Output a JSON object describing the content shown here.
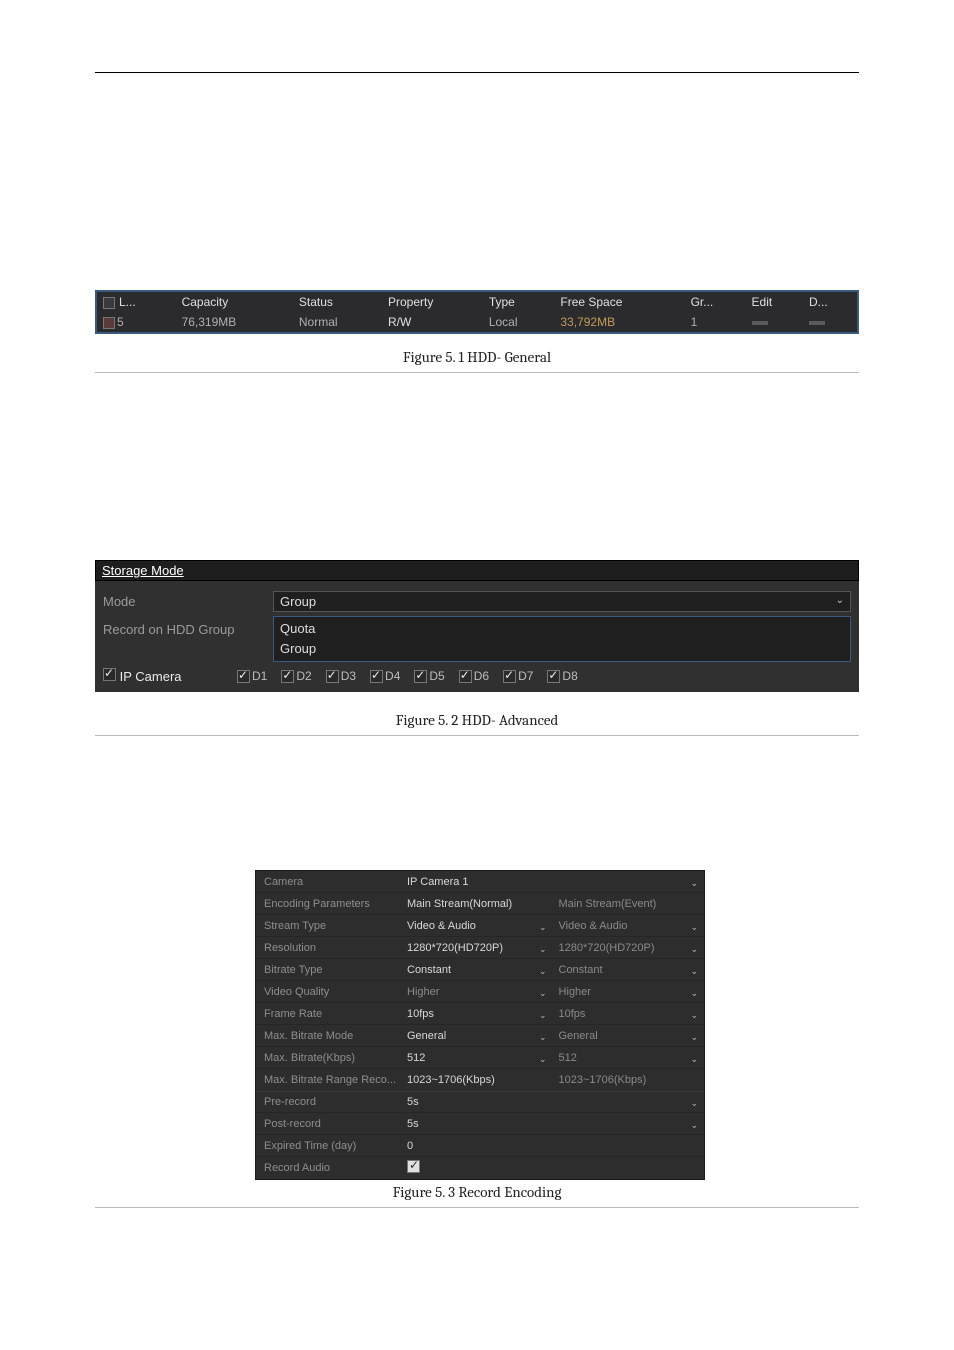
{
  "captions": {
    "fig1": "Figure 5. 1 HDD- General",
    "fig2": "Figure 5. 2 HDD- Advanced",
    "fig3": "Figure 5. 3 Record Encoding"
  },
  "hdd_general": {
    "headers": [
      "L...",
      "Capacity",
      "Status",
      "Property",
      "Type",
      "Free Space",
      "Gr...",
      "Edit",
      "D..."
    ],
    "row": {
      "label": "5",
      "capacity": "76,319MB",
      "status": "Normal",
      "property": "R/W",
      "type": "Local",
      "free_space": "33,792MB",
      "group": "1",
      "edit": "–",
      "delete": "–"
    }
  },
  "hdd_advanced": {
    "title": "Storage Mode",
    "labels": {
      "mode": "Mode",
      "record_on": "Record on HDD Group",
      "ip_camera": "IP Camera"
    },
    "mode_selected": "Group",
    "mode_options": [
      "Quota",
      "Group"
    ],
    "cameras": [
      "D1",
      "D2",
      "D3",
      "D4",
      "D5",
      "D6",
      "D7",
      "D8"
    ]
  },
  "encoding": {
    "camera_label": "Camera",
    "camera_value": "IP Camera 1",
    "rows": [
      {
        "label": "Encoding Parameters",
        "a": "Main Stream(Normal)",
        "b": "Main Stream(Event)",
        "aCaret": false,
        "bCaret": false,
        "bDim": true
      },
      {
        "label": "Stream Type",
        "a": "Video & Audio",
        "b": "Video & Audio",
        "aCaret": true,
        "bCaret": true,
        "bDim": true
      },
      {
        "label": "Resolution",
        "a": "1280*720(HD720P)",
        "b": "1280*720(HD720P)",
        "aCaret": true,
        "bCaret": true,
        "bDim": true
      },
      {
        "label": "Bitrate Type",
        "a": "Constant",
        "b": "Constant",
        "aCaret": true,
        "bCaret": true,
        "bDim": true
      },
      {
        "label": "Video Quality",
        "a": "Higher",
        "b": "Higher",
        "aCaret": true,
        "bCaret": true,
        "bDim": true,
        "aDim": true
      },
      {
        "label": "Frame Rate",
        "a": "10fps",
        "b": "10fps",
        "aCaret": true,
        "bCaret": true,
        "bDim": true
      },
      {
        "label": "Max. Bitrate Mode",
        "a": "General",
        "b": "General",
        "aCaret": true,
        "bCaret": true,
        "bDim": true
      },
      {
        "label": "Max. Bitrate(Kbps)",
        "a": "512",
        "b": "512",
        "aCaret": true,
        "bCaret": true,
        "bDim": true
      },
      {
        "label": "Max. Bitrate Range Reco...",
        "a": "1023~1706(Kbps)",
        "b": "1023~1706(Kbps)",
        "aCaret": false,
        "bCaret": false,
        "bDim": true
      }
    ],
    "bottom": {
      "pre_record_label": "Pre-record",
      "pre_record_value": "5s",
      "post_record_label": "Post-record",
      "post_record_value": "5s",
      "expired_label": "Expired Time (day)",
      "expired_value": "0",
      "record_audio_label": "Record Audio"
    }
  }
}
